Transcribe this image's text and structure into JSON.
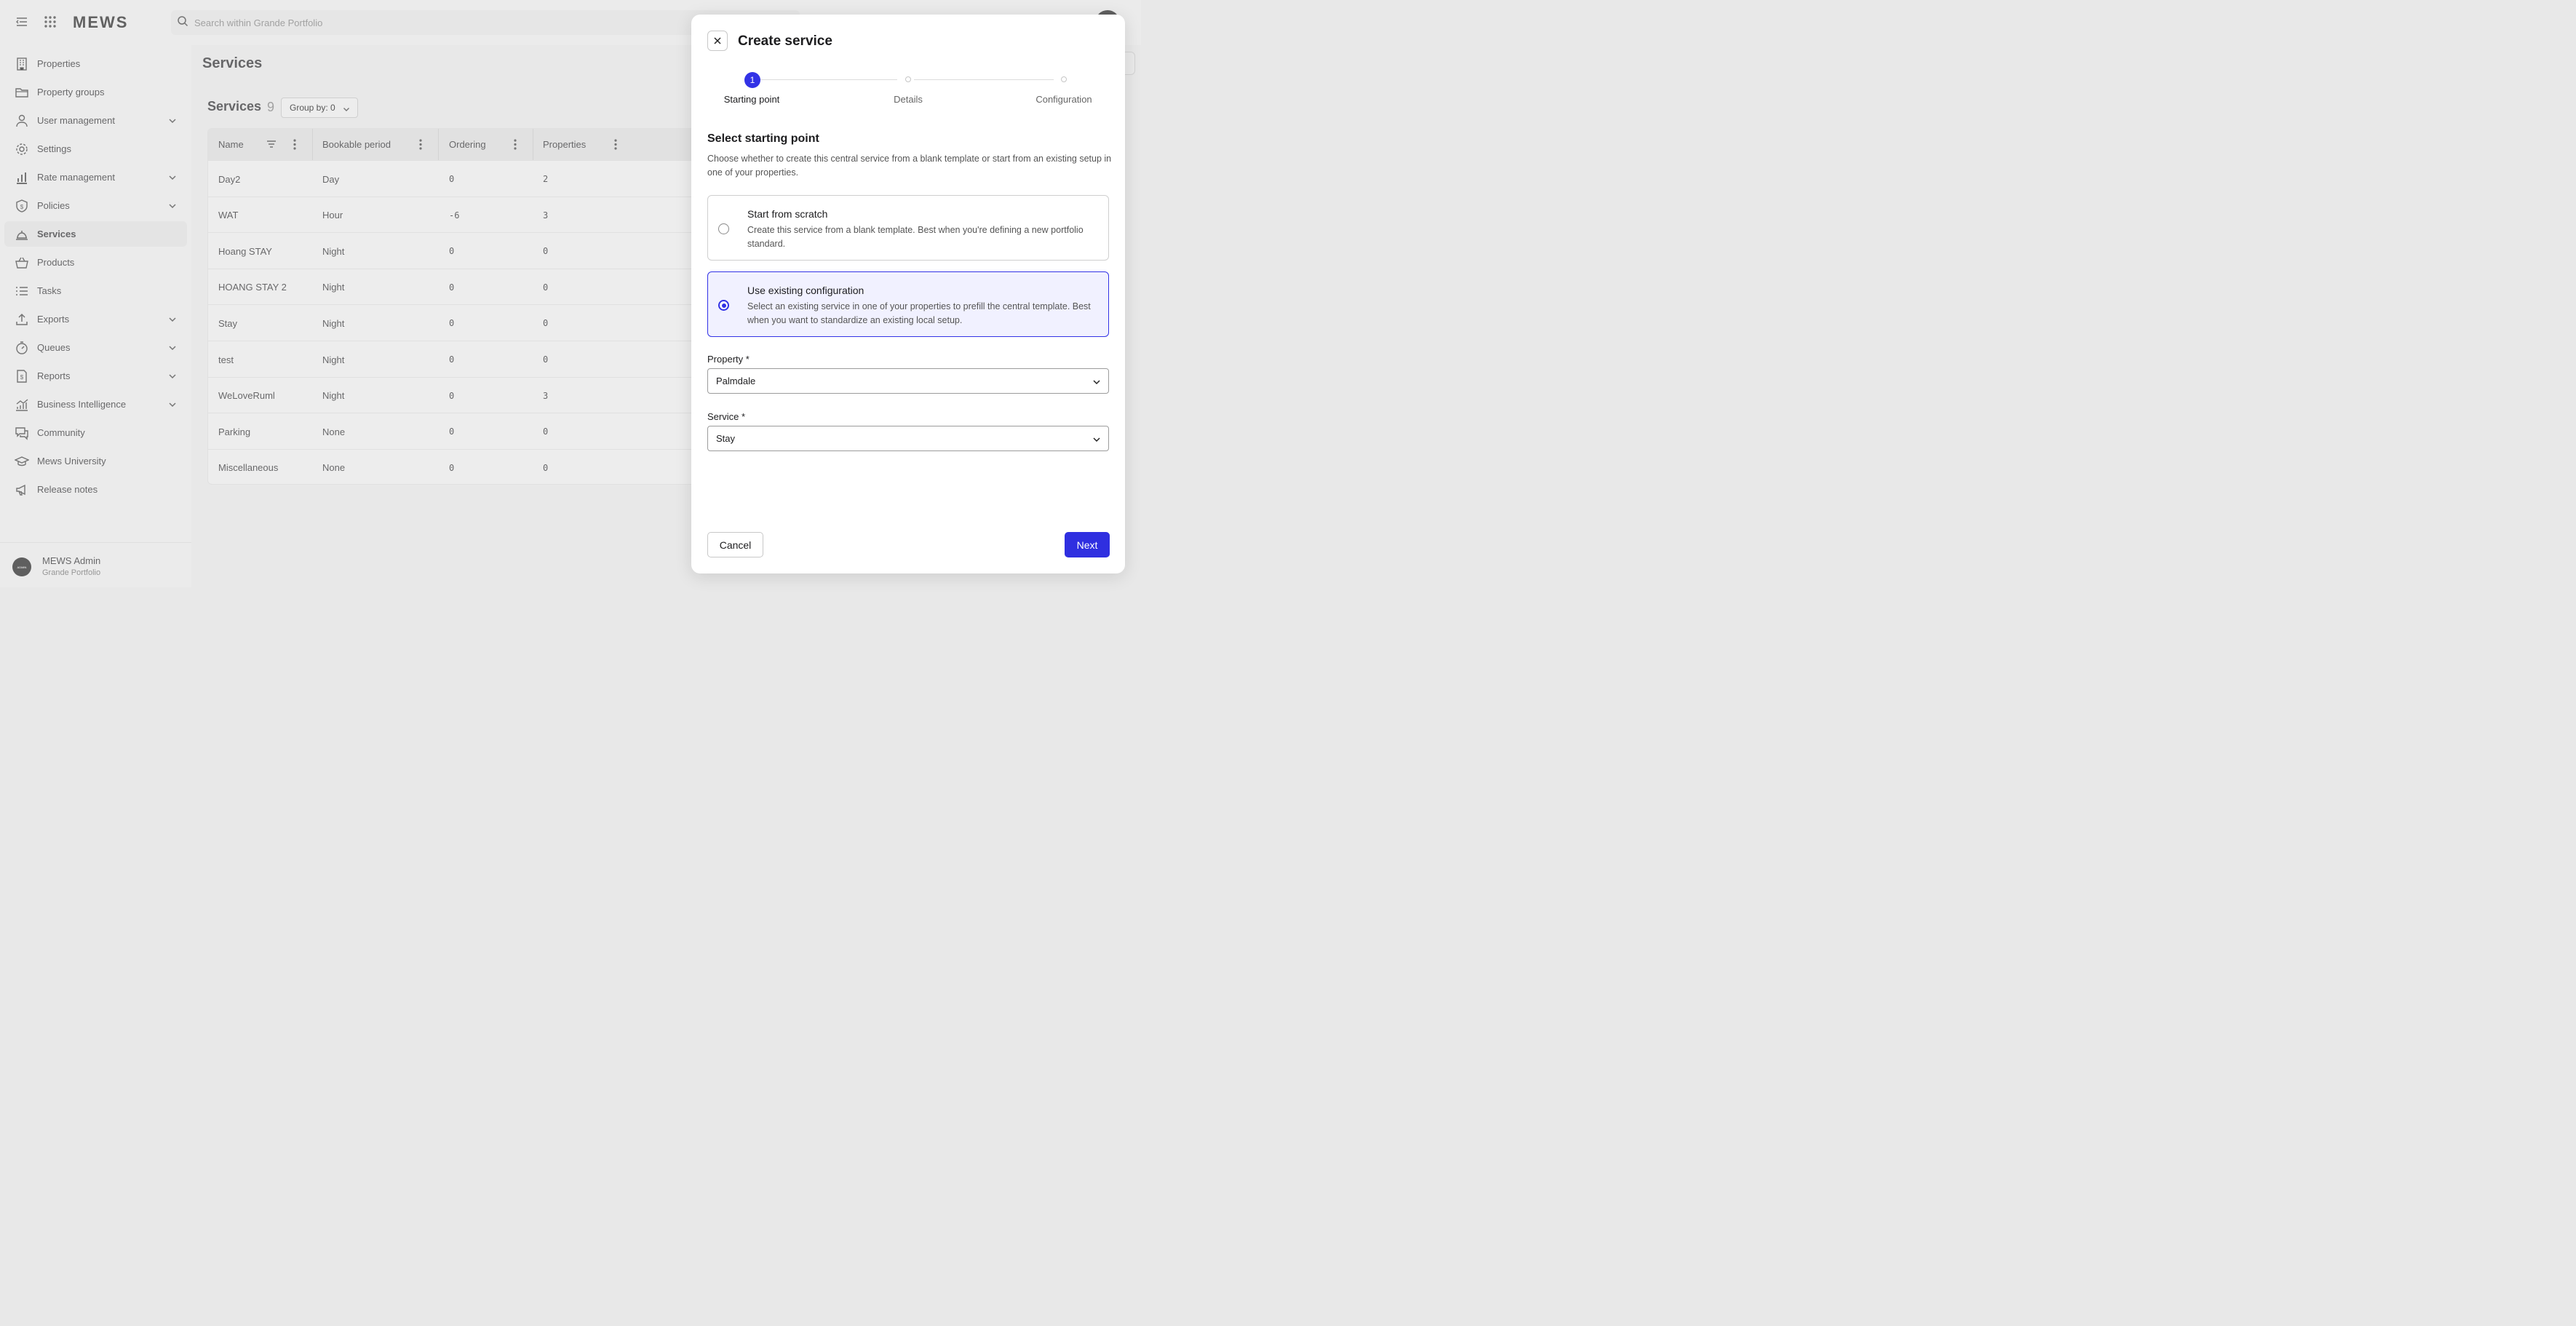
{
  "header": {
    "logo": "MEWS",
    "search_placeholder": "Search within Grande Portfolio"
  },
  "sidebar": {
    "items": [
      {
        "label": "Properties",
        "icon": "building-icon",
        "expandable": false,
        "active": false
      },
      {
        "label": "Property groups",
        "icon": "folder-icon",
        "expandable": false,
        "active": false
      },
      {
        "label": "User management",
        "icon": "user-icon",
        "expandable": true,
        "active": false
      },
      {
        "label": "Settings",
        "icon": "gear-icon",
        "expandable": false,
        "active": false
      },
      {
        "label": "Rate management",
        "icon": "bar-chart-icon",
        "expandable": true,
        "active": false
      },
      {
        "label": "Policies",
        "icon": "shield-dollar-icon",
        "expandable": true,
        "active": false
      },
      {
        "label": "Services",
        "icon": "service-bell-icon",
        "expandable": false,
        "active": true
      },
      {
        "label": "Products",
        "icon": "basket-icon",
        "expandable": false,
        "active": false
      },
      {
        "label": "Tasks",
        "icon": "checklist-icon",
        "expandable": false,
        "active": false
      },
      {
        "label": "Exports",
        "icon": "upload-icon",
        "expandable": true,
        "active": false
      },
      {
        "label": "Queues",
        "icon": "timer-icon",
        "expandable": true,
        "active": false
      },
      {
        "label": "Reports",
        "icon": "document-dollar-icon",
        "expandable": true,
        "active": false
      },
      {
        "label": "Business Intelligence",
        "icon": "trend-chart-icon",
        "expandable": true,
        "active": false
      },
      {
        "label": "Community",
        "icon": "chat-icon",
        "expandable": false,
        "active": false
      },
      {
        "label": "Mews University",
        "icon": "graduation-cap-icon",
        "expandable": false,
        "active": false
      },
      {
        "label": "Release notes",
        "icon": "megaphone-icon",
        "expandable": false,
        "active": false
      }
    ],
    "footer": {
      "avatar_text": "ADMIN",
      "name": "MEWS Admin",
      "subtitle": "Grande Portfolio"
    }
  },
  "main": {
    "page_title": "Services",
    "section_title": "Services",
    "section_count": "9",
    "group_by_label": "Group by: 0",
    "columns": [
      "Name",
      "Bookable period",
      "Ordering",
      "Properties"
    ],
    "rows": [
      {
        "name": "Day2",
        "period": "Day",
        "ordering": "0",
        "properties": "2"
      },
      {
        "name": "WAT",
        "period": "Hour",
        "ordering": "-6",
        "properties": "3"
      },
      {
        "name": "Hoang STAY",
        "period": "Night",
        "ordering": "0",
        "properties": "0"
      },
      {
        "name": "HOANG STAY 2",
        "period": "Night",
        "ordering": "0",
        "properties": "0"
      },
      {
        "name": "Stay",
        "period": "Night",
        "ordering": "0",
        "properties": "0"
      },
      {
        "name": "test",
        "period": "Night",
        "ordering": "0",
        "properties": "0"
      },
      {
        "name": "WeLoveRuml",
        "period": "Night",
        "ordering": "0",
        "properties": "3"
      },
      {
        "name": "Parking",
        "period": "None",
        "ordering": "0",
        "properties": "0"
      },
      {
        "name": "Miscellaneous",
        "period": "None",
        "ordering": "0",
        "properties": "0"
      }
    ]
  },
  "dialog": {
    "title": "Create service",
    "steps": [
      {
        "number": "1",
        "label": "Starting point",
        "active": true
      },
      {
        "number": "",
        "label": "Details",
        "active": false
      },
      {
        "number": "",
        "label": "Configuration",
        "active": false
      }
    ],
    "section_title": "Select starting point",
    "section_desc": "Choose whether to create this central service from a blank template or start from an existing setup in one of your properties.",
    "options": [
      {
        "title": "Start from scratch",
        "desc": "Create this service from a blank template. Best when you're defining a new portfolio standard.",
        "selected": false
      },
      {
        "title": "Use existing configuration",
        "desc": "Select an existing service in one of your properties to prefill the central template. Best when you want to standardize an existing local setup.",
        "selected": true
      }
    ],
    "property_label": "Property *",
    "property_value": "Palmdale",
    "service_label": "Service *",
    "service_value": "Stay",
    "cancel_label": "Cancel",
    "next_label": "Next"
  },
  "colors": {
    "accent": "#3232e6",
    "selected_option_bg": "#f1f1ff",
    "sidebar_active_bg": "#dddddd"
  }
}
